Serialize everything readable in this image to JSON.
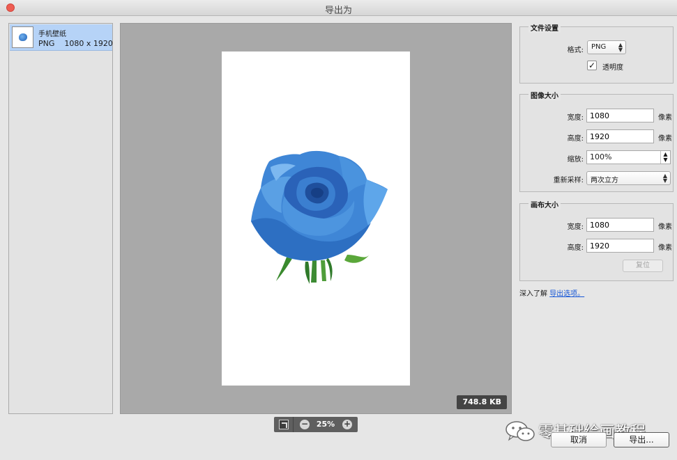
{
  "window": {
    "title": "导出为"
  },
  "assets": [
    {
      "name": "手机壁纸",
      "format": "PNG",
      "dimensions": "1080 x 1920"
    }
  ],
  "preview": {
    "file_size": "748.8 KB",
    "zoom": "25%"
  },
  "file_settings": {
    "title": "文件设置",
    "format_label": "格式:",
    "format_value": "PNG",
    "transparency_label": "透明度",
    "transparency_checked": true
  },
  "image_size": {
    "title": "图像大小",
    "width_label": "宽度:",
    "width_value": "1080",
    "height_label": "高度:",
    "height_value": "1920",
    "scale_label": "缩放:",
    "scale_value": "100%",
    "resample_label": "重新采样:",
    "resample_value": "两次立方",
    "unit": "像素"
  },
  "canvas_size": {
    "title": "画布大小",
    "width_label": "宽度:",
    "width_value": "1080",
    "height_label": "高度:",
    "height_value": "1920",
    "unit": "像素",
    "reset_label": "复位"
  },
  "learn_more": {
    "prefix": "深入了解",
    "link": "导出选项。"
  },
  "buttons": {
    "cancel": "取消",
    "export": "导出..."
  },
  "watermark": {
    "text": "零基础绘画教程"
  },
  "colors": {
    "close": "#ee5d52",
    "selection": "#b6d3f7",
    "link": "#1556d6",
    "preview_bg": "#a9a9a9"
  }
}
